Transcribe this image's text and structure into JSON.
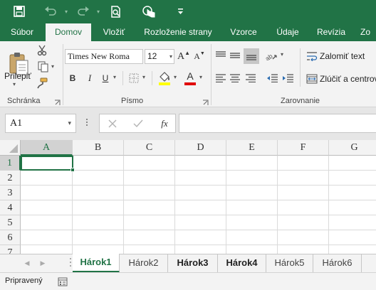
{
  "quick_access": {
    "icons": [
      "save-icon",
      "undo-icon",
      "redo-icon",
      "print-preview-icon",
      "touch-mode-icon",
      "customize-icon"
    ]
  },
  "ribbon_tabs": [
    "Súbor",
    "Domov",
    "Vložiť",
    "Rozloženie strany",
    "Vzorce",
    "Údaje",
    "Revízia",
    "Zo"
  ],
  "active_tab": "Domov",
  "clipboard": {
    "paste_label": "Prilepiť",
    "group_label": "Schránka"
  },
  "font": {
    "family": "Times New Roma",
    "size": "12",
    "group_label": "Písmo",
    "bold": "B",
    "italic": "I",
    "underline": "U",
    "font_color_letter": "A",
    "grow": "A",
    "shrink": "A"
  },
  "alignment": {
    "wrap_text": "Zalomiť text",
    "merge_center": "Zlúčiť a centrov",
    "group_label": "Zarovnanie"
  },
  "formula_bar": {
    "name_box": "A1",
    "fx": "fx",
    "formula": ""
  },
  "grid": {
    "columns": [
      "A",
      "B",
      "C",
      "D",
      "E",
      "F",
      "G"
    ],
    "rows": [
      "1",
      "2",
      "3",
      "4",
      "5",
      "6",
      "7"
    ],
    "active_cell": "A1"
  },
  "sheets": [
    {
      "name": "Hárok1",
      "active": true,
      "bold": true
    },
    {
      "name": "Hárok2",
      "active": false,
      "bold": false
    },
    {
      "name": "Hárok3",
      "active": false,
      "bold": true
    },
    {
      "name": "Hárok4",
      "active": false,
      "bold": true
    },
    {
      "name": "Hárok5",
      "active": false,
      "bold": false
    },
    {
      "name": "Hárok6",
      "active": false,
      "bold": false
    }
  ],
  "status": {
    "text": "Pripravený"
  },
  "colors": {
    "accent": "#217346",
    "highlight": "#ffff00",
    "font_color": "#e00000"
  }
}
